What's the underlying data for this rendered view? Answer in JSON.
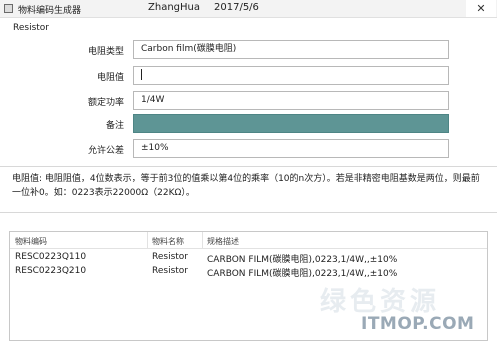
{
  "window": {
    "title": "物料编码生成器",
    "author": "ZhangHua",
    "date": "2017/5/6",
    "close_glyph": "✕"
  },
  "form": {
    "group_label": "Resistor",
    "fields": [
      {
        "label": "电阻类型",
        "value": "Carbon film(碳膜电阻)"
      },
      {
        "label": "电阻值",
        "value": ""
      },
      {
        "label": "额定功率",
        "value": "1/4W"
      },
      {
        "label": "备注",
        "value": ""
      },
      {
        "label": "允许公差",
        "value": "±10%"
      }
    ]
  },
  "info": {
    "text": "电阻值: 电阻阻值，4位数表示，等于前3位的值乘以第4位的乘率（10的n次方）。若是非精密电阻基数是两位，则最前一位补0。如：0223表示22000Ω（22KΩ）。"
  },
  "table": {
    "columns": [
      "物料编码",
      "物料名称",
      "规格描述"
    ],
    "rows": [
      [
        "RESC0223Q110",
        "Resistor",
        "CARBON FILM(碳膜电阻),0223,1/4W,,±10%"
      ],
      [
        "RESC0223Q210",
        "Resistor",
        "CARBON FILM(碳膜电阻),0223,1/4W,,±10%"
      ]
    ]
  },
  "watermark": {
    "faint": "绿色资源",
    "text": "ITMOP.COM"
  },
  "colors": {
    "remark_field": "#5e9595"
  }
}
